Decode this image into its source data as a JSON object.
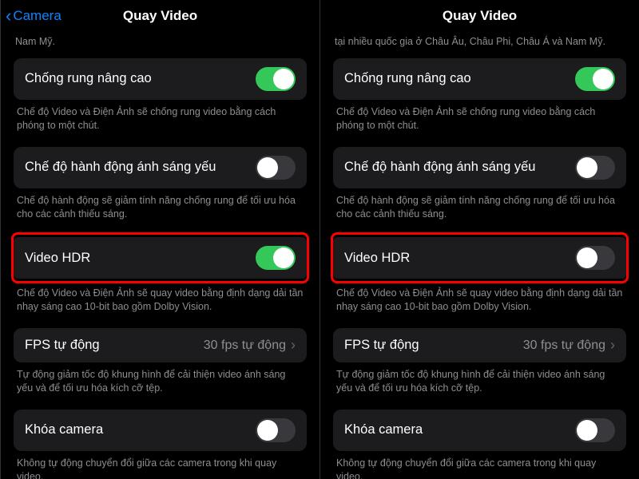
{
  "left": {
    "nav": {
      "back": "Camera",
      "title": "Quay Video"
    },
    "top_snippet": "Nam Mỹ.",
    "rows": [
      {
        "label": "Chống rung nâng cao",
        "toggle": true,
        "footer": "Chế độ Video và Điện Ảnh sẽ chống rung video bằng cách phóng to một chút.",
        "highlight": false,
        "interactable": true,
        "name": "toggle-stabilization"
      },
      {
        "label": "Chế độ hành động ánh sáng yếu",
        "toggle": false,
        "footer": "Chế độ hành động sẽ giảm tính năng chống rung để tối ưu hóa cho các cảnh thiếu sáng.",
        "highlight": false,
        "interactable": true,
        "name": "toggle-action-lowlight"
      },
      {
        "label": "Video HDR",
        "toggle": true,
        "footer": "Chế độ Video và Điện Ảnh sẽ quay video bằng định dạng dải tần nhạy sáng cao 10-bit bao gồm Dolby Vision.",
        "highlight": true,
        "interactable": true,
        "name": "toggle-hdr-video"
      },
      {
        "type": "link",
        "label": "FPS tự động",
        "value": "30 fps tự động",
        "footer": "Tự động giảm tốc độ khung hình để cải thiện video ánh sáng yếu và để tối ưu hóa kích cỡ tệp.",
        "highlight": false,
        "interactable": true,
        "name": "link-auto-fps"
      },
      {
        "label": "Khóa camera",
        "toggle": false,
        "footer": "Không tự động chuyển đổi giữa các camera trong khi quay video.",
        "highlight": false,
        "interactable": true,
        "name": "toggle-lock-camera"
      }
    ]
  },
  "right": {
    "nav": {
      "back": "",
      "title": "Quay Video"
    },
    "top_snippet": "tại nhiều quốc gia ở Châu Âu, Châu Phi, Châu Á và Nam Mỹ.",
    "rows": [
      {
        "label": "Chống rung nâng cao",
        "toggle": true,
        "footer": "Chế độ Video và Điện Ảnh sẽ chống rung video bằng cách phóng to một chút.",
        "highlight": false,
        "interactable": true,
        "name": "toggle-stabilization"
      },
      {
        "label": "Chế độ hành động ánh sáng yếu",
        "toggle": false,
        "footer": "Chế độ hành động sẽ giảm tính năng chống rung để tối ưu hóa cho các cảnh thiếu sáng.",
        "highlight": false,
        "interactable": true,
        "name": "toggle-action-lowlight"
      },
      {
        "label": "Video HDR",
        "toggle": false,
        "footer": "Chế độ Video và Điện Ảnh sẽ quay video bằng định dạng dải tần nhạy sáng cao 10-bit bao gồm Dolby Vision.",
        "highlight": true,
        "interactable": true,
        "name": "toggle-hdr-video"
      },
      {
        "type": "link",
        "label": "FPS tự động",
        "value": "30 fps tự động",
        "footer": "Tự động giảm tốc độ khung hình để cải thiện video ánh sáng yếu và để tối ưu hóa kích cỡ tệp.",
        "highlight": false,
        "interactable": true,
        "name": "link-auto-fps"
      },
      {
        "label": "Khóa camera",
        "toggle": false,
        "footer": "Không tự động chuyển đổi giữa các camera trong khi quay video.",
        "highlight": false,
        "interactable": true,
        "name": "toggle-lock-camera"
      }
    ]
  }
}
